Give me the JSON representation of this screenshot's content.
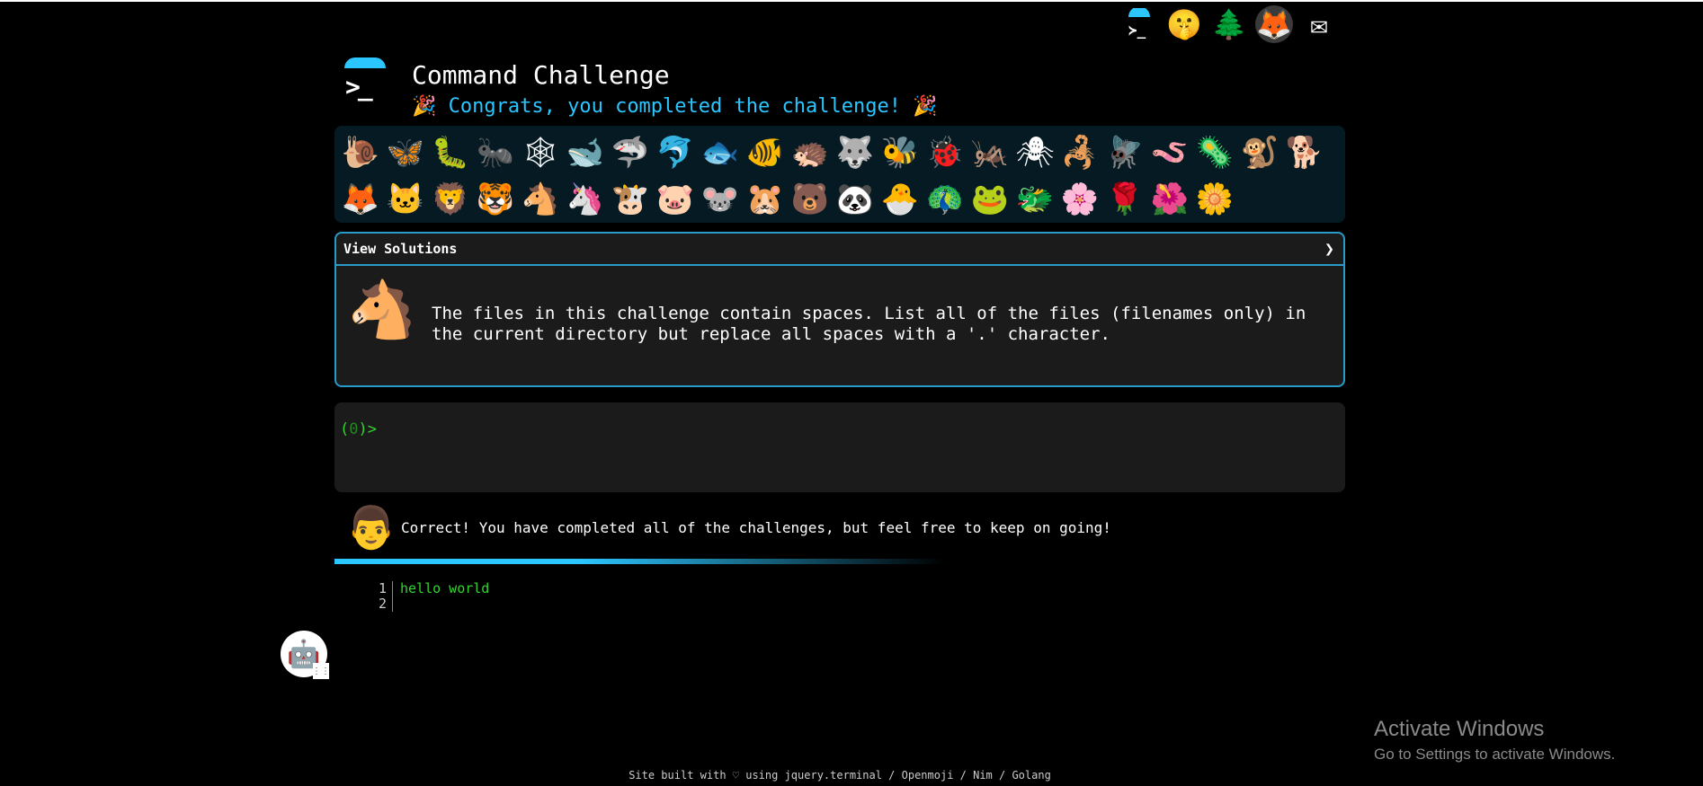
{
  "topbar": {
    "icons": [
      {
        "name": "terminal-logo-icon",
        "glyph": "≻"
      },
      {
        "name": "shush-face-icon",
        "glyph": "🤫"
      },
      {
        "name": "tree-icon",
        "glyph": "🌲"
      },
      {
        "name": "gitlab-icon",
        "glyph": "🦊"
      },
      {
        "name": "mail-icon",
        "glyph": "✉"
      }
    ]
  },
  "header": {
    "title": "Command Challenge",
    "subtitle": "🎉 Congrats, you completed the challenge! 🎉",
    "logo_prompt": ">_"
  },
  "emojis": [
    "🐌",
    "🦋",
    "🐛",
    "🐜",
    "🕸",
    "🐋",
    "🦈",
    "🐬",
    "🐟",
    "🐠",
    "🦔",
    "🐺",
    "🐝",
    "🐞",
    "🦗",
    "🕷",
    "🦂",
    "🪰",
    "🪱",
    "🦠",
    "🐒",
    "🐕",
    "🦊",
    "🐱",
    "🦁",
    "🐯",
    "🐴",
    "🦄",
    "🐮",
    "🐷",
    "🐭",
    "🐹",
    "🐻",
    "🐼",
    "🐣",
    "🦚",
    "🐸",
    "🐲",
    "🌸",
    "🌹",
    "🌺",
    "🌼"
  ],
  "solutions": {
    "title": "View Solutions",
    "arrow": "❯",
    "icon": "🐴",
    "text": "The files in this challenge contain spaces. List all of the files (filenames only) in the current directory but replace all spaces with a '.' character."
  },
  "terminal": {
    "prompt_open": "(",
    "prompt_count": "0",
    "prompt_close": ")>"
  },
  "feedback": {
    "icon": "👨",
    "text": "Correct! You have completed all of the challenges, but feel free to keep on going!"
  },
  "output": {
    "lines": [
      {
        "no": "1",
        "text": "hello world"
      },
      {
        "no": "2",
        "text": ""
      }
    ]
  },
  "bot": {
    "glyph": "🤖",
    "corner": "⋮⋮"
  },
  "watermark": {
    "title": "Activate Windows",
    "subtitle": "Go to Settings to activate Windows."
  },
  "footer": {
    "text": "Site built with ♡ using jquery.terminal / Openmoji / Nim / Golang"
  }
}
